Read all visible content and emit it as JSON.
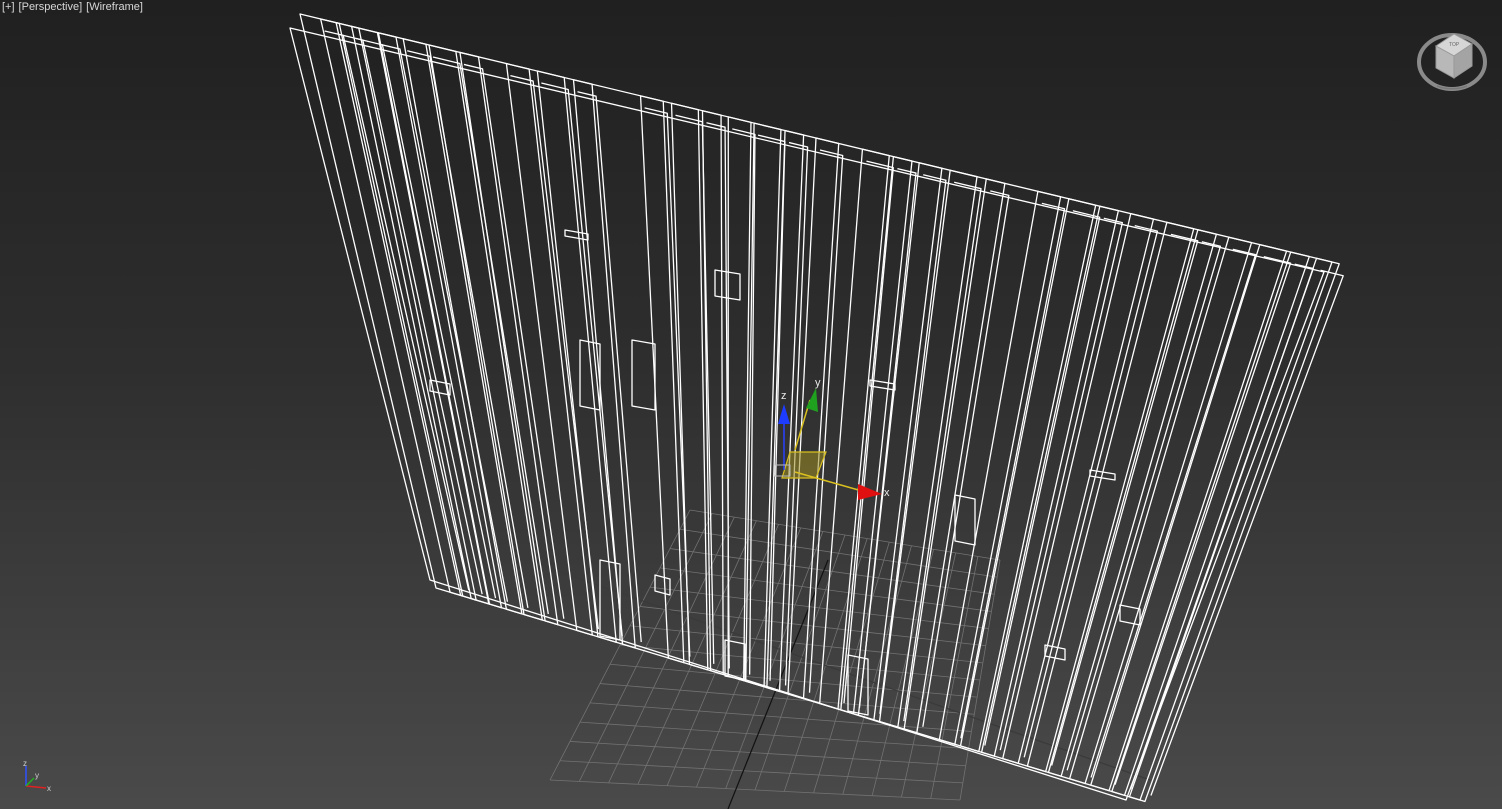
{
  "viewport": {
    "menu_label": "[+]",
    "view_label": "[Perspective]",
    "shading_label": "[Wireframe]"
  },
  "gizmo": {
    "x_label": "x",
    "y_label": "y",
    "z_label": "z",
    "colors": {
      "x": "#e01010",
      "y": "#1fa01f",
      "z": "#1e3cff",
      "plane": "#d9c020"
    }
  },
  "viewcube": {
    "face_label": "TOP",
    "icon": "viewcube-icon"
  },
  "axis_tripod": {
    "x_label": "x",
    "y_label": "y",
    "z_label": "z"
  },
  "colors": {
    "wireframe": "#ffffff",
    "grid": "#7a7a7a",
    "background_top": "#202020",
    "background_bottom": "#4a4a4a"
  }
}
